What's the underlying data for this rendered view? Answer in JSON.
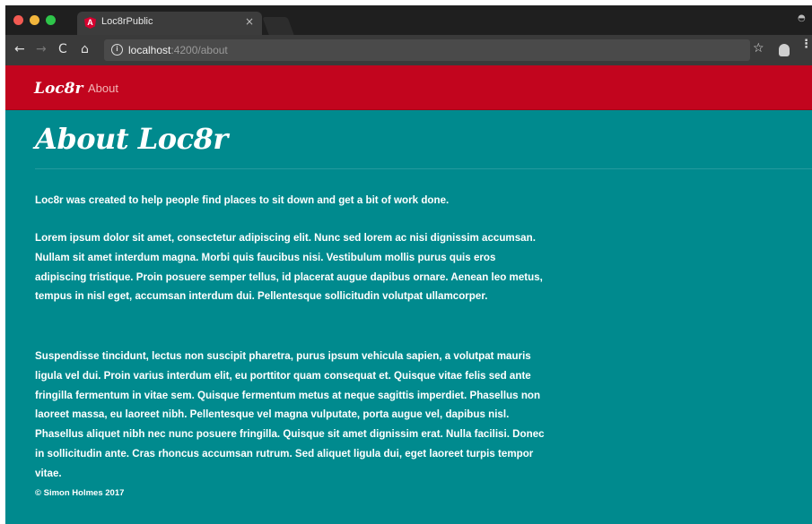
{
  "browser": {
    "tab": {
      "title": "Loc8rPublic",
      "favicon_letter": "A",
      "close": "×"
    },
    "toolbar": {
      "back": "←",
      "forward": "→",
      "reload": "C",
      "home": "⌂",
      "info": "i",
      "url_host": "localhost",
      "url_rest": ":4200/about",
      "star": "☆",
      "menu": "⋮"
    }
  },
  "site": {
    "brand": "Loc8r",
    "nav": [
      {
        "label": "About"
      }
    ]
  },
  "page": {
    "title": "About Loc8r",
    "paragraphs": [
      "Loc8r was created to help people find places to sit down and get a bit of work done.",
      "Lorem ipsum dolor sit amet, consectetur adipiscing elit. Nunc sed lorem ac nisi dignissim accumsan. Nullam sit amet interdum magna. Morbi quis faucibus nisi. Vestibulum mollis purus quis eros adipiscing tristique. Proin posuere semper tellus, id placerat augue dapibus ornare. Aenean leo metus, tempus in nisl eget, accumsan interdum dui. Pellentesque sollicitudin volutpat ullamcorper.",
      "Suspendisse tincidunt, lectus non suscipit pharetra, purus ipsum vehicula sapien, a volutpat mauris ligula vel dui. Proin varius interdum elit, eu porttitor quam consequat et. Quisque vitae felis sed ante fringilla fermentum in vitae sem. Quisque fermentum metus at neque sagittis imperdiet. Phasellus non laoreet massa, eu laoreet nibh. Pellentesque vel magna vulputate, porta augue vel, dapibus nisl. Phasellus aliquet nibh nec nunc posuere fringilla. Quisque sit amet dignissim erat. Nulla facilisi. Donec in sollicitudin ante. Cras rhoncus accumsan rutrum. Sed aliquet ligula dui, eget laoreet turpis tempor vitae."
    ],
    "footer": "© Simon Holmes 2017"
  },
  "colors": {
    "navbar": "#c2051e",
    "background": "#008a8e",
    "text": "#ffffff"
  }
}
